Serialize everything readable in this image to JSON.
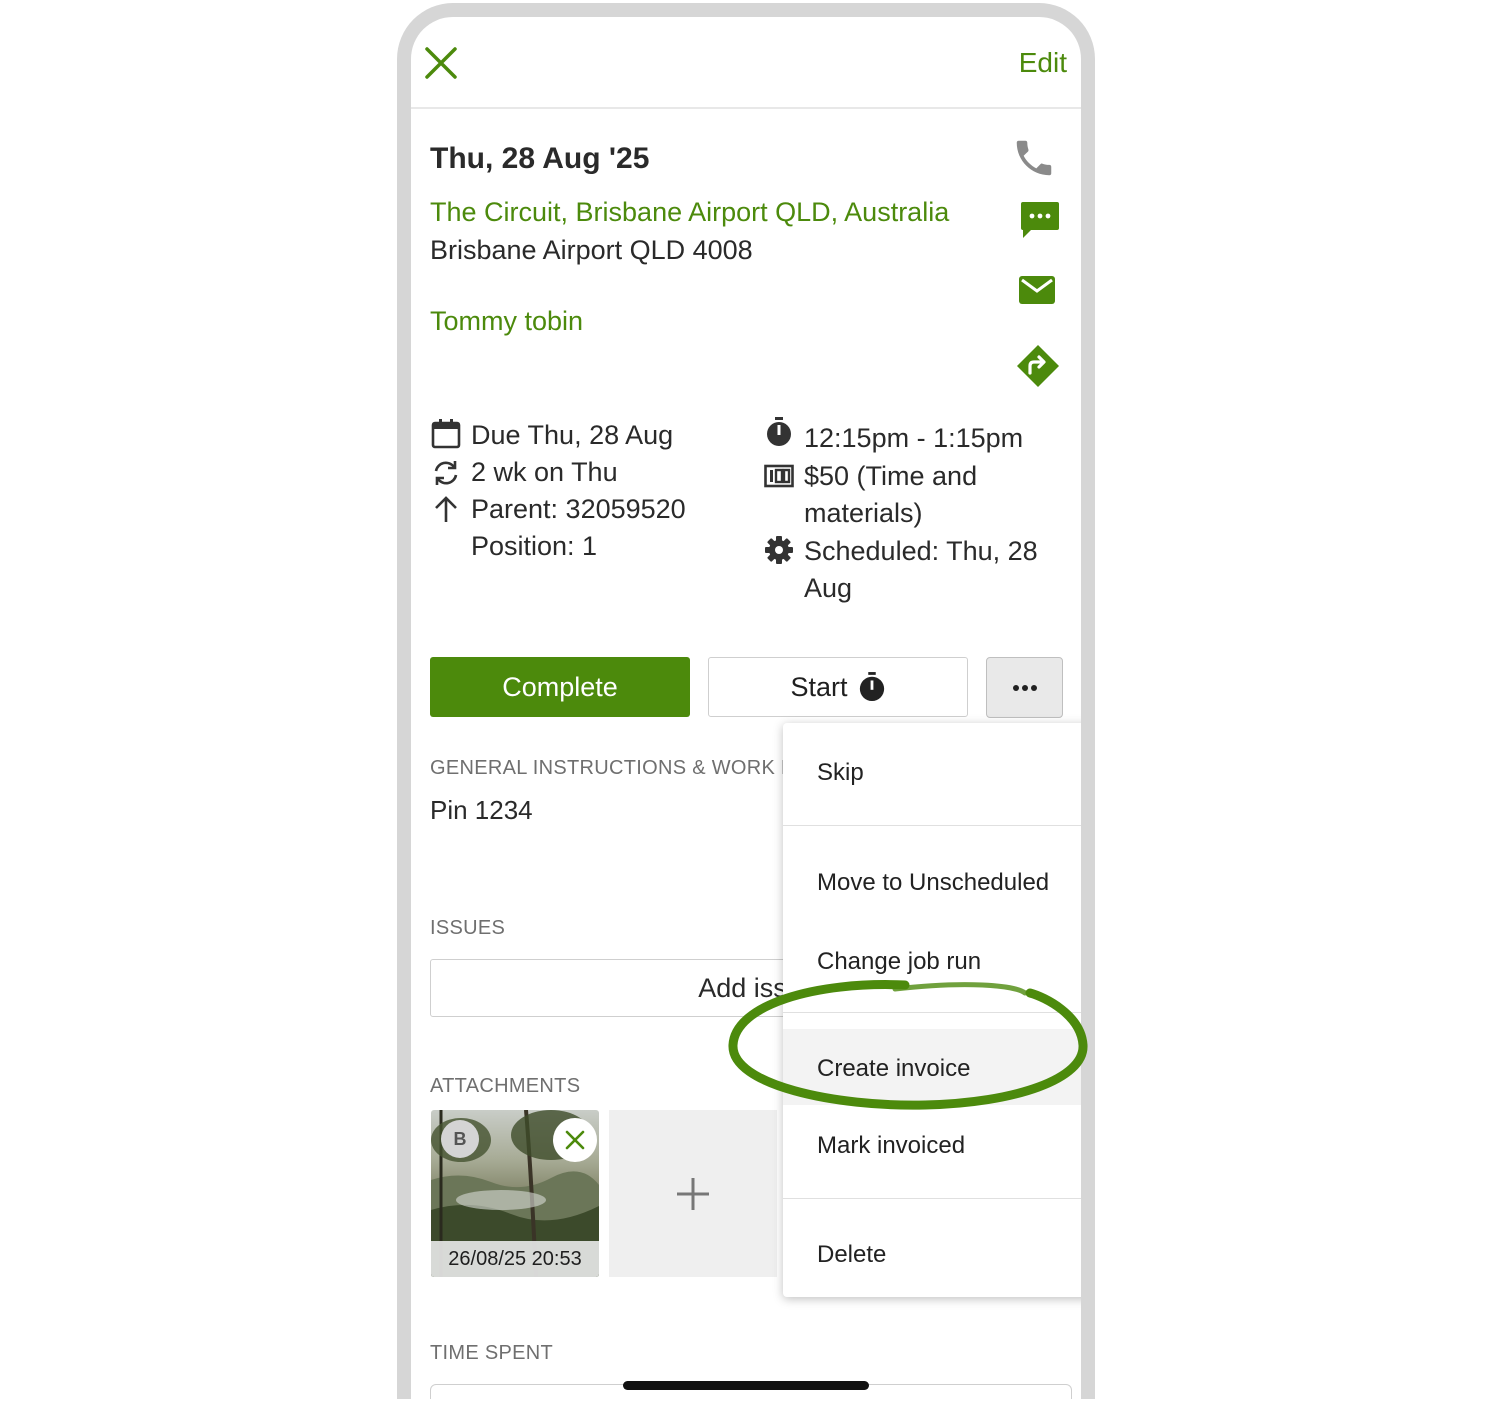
{
  "header": {
    "edit_label": "Edit"
  },
  "job": {
    "date_title": "Thu, 28 Aug '25",
    "address_line1": "The Circuit, Brisbane Airport QLD, Australia",
    "address_line2": "Brisbane Airport QLD 4008",
    "contact_name": "Tommy tobin",
    "due": "Due Thu, 28 Aug",
    "recurrence": "2 wk on Thu",
    "parent": "Parent: 32059520",
    "position": "Position: 1",
    "time_window": "12:15pm - 1:15pm",
    "price_line1": "$50 (Time and",
    "price_line2": "materials)",
    "scheduled_line1": "Scheduled: Thu, 28",
    "scheduled_line2": "Aug"
  },
  "actions": {
    "complete_label": "Complete",
    "start_label": "Start"
  },
  "sections": {
    "instructions_label": "GENERAL INSTRUCTIONS & WORK R",
    "instructions_value": "Pin 1234",
    "issues_label": "ISSUES",
    "add_issue_label": "Add issu",
    "attachments_label": "ATTACHMENTS",
    "attachment_avatar": "B",
    "attachment_caption": "26/08/25 20:53",
    "time_spent_label": "TIME SPENT"
  },
  "menu": {
    "items": [
      {
        "label": "Skip"
      },
      {
        "label": "Move to Unscheduled"
      },
      {
        "label": "Change job run"
      },
      {
        "label": "Create invoice"
      },
      {
        "label": "Mark invoiced"
      },
      {
        "label": "Delete"
      }
    ]
  },
  "colors": {
    "accent": "#4c8a0c",
    "highlight_ring": "#4c8a0c",
    "menu_hover": "#f3f3f3"
  },
  "icons": [
    "close-icon",
    "phone-icon",
    "message-icon",
    "email-icon",
    "directions-icon",
    "calendar-icon",
    "repeat-icon",
    "arrow-up-icon",
    "timer-icon",
    "price-icon",
    "gear-icon",
    "more-icon",
    "plus-icon"
  ]
}
